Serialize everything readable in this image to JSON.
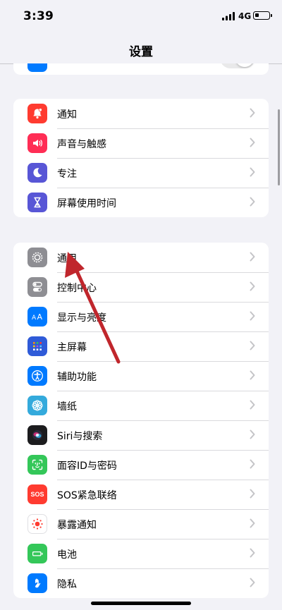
{
  "status_bar": {
    "time": "3:39",
    "network": "4G"
  },
  "nav": {
    "title": "设置"
  },
  "group1": {
    "items": [
      {
        "label": "通知",
        "icon": "bell-icon",
        "color": "#ff3b30"
      },
      {
        "label": "声音与触感",
        "icon": "speaker-icon",
        "color": "#ff2d55"
      },
      {
        "label": "专注",
        "icon": "moon-icon",
        "color": "#5856d6"
      },
      {
        "label": "屏幕使用时间",
        "icon": "hourglass-icon",
        "color": "#5856d6"
      }
    ]
  },
  "group2": {
    "items": [
      {
        "label": "通用",
        "icon": "gear-icon",
        "color": "#8e8e93"
      },
      {
        "label": "控制中心",
        "icon": "switches-icon",
        "color": "#8e8e93"
      },
      {
        "label": "显示与亮度",
        "icon": "text-size-icon",
        "color": "#007aff"
      },
      {
        "label": "主屏幕",
        "icon": "home-grid-icon",
        "color": "#2f5bd8"
      },
      {
        "label": "辅助功能",
        "icon": "accessibility-icon",
        "color": "#007aff"
      },
      {
        "label": "墙纸",
        "icon": "flower-icon",
        "color": "#34aadc"
      },
      {
        "label": "Siri与搜索",
        "icon": "siri-icon",
        "color": "#1c1c1e"
      },
      {
        "label": "面容ID与密码",
        "icon": "face-id-icon",
        "color": "#34c759"
      },
      {
        "label": "SOS紧急联络",
        "icon": "sos-icon",
        "color": "#ff3b30"
      },
      {
        "label": "暴露通知",
        "icon": "exposure-icon",
        "color": "#ffffff"
      },
      {
        "label": "电池",
        "icon": "battery-icon",
        "color": "#34c759"
      },
      {
        "label": "隐私",
        "icon": "hand-icon",
        "color": "#007aff"
      }
    ]
  },
  "sos_badge": "SOS",
  "accent": {
    "annotation_arrow": "#c0262c"
  }
}
